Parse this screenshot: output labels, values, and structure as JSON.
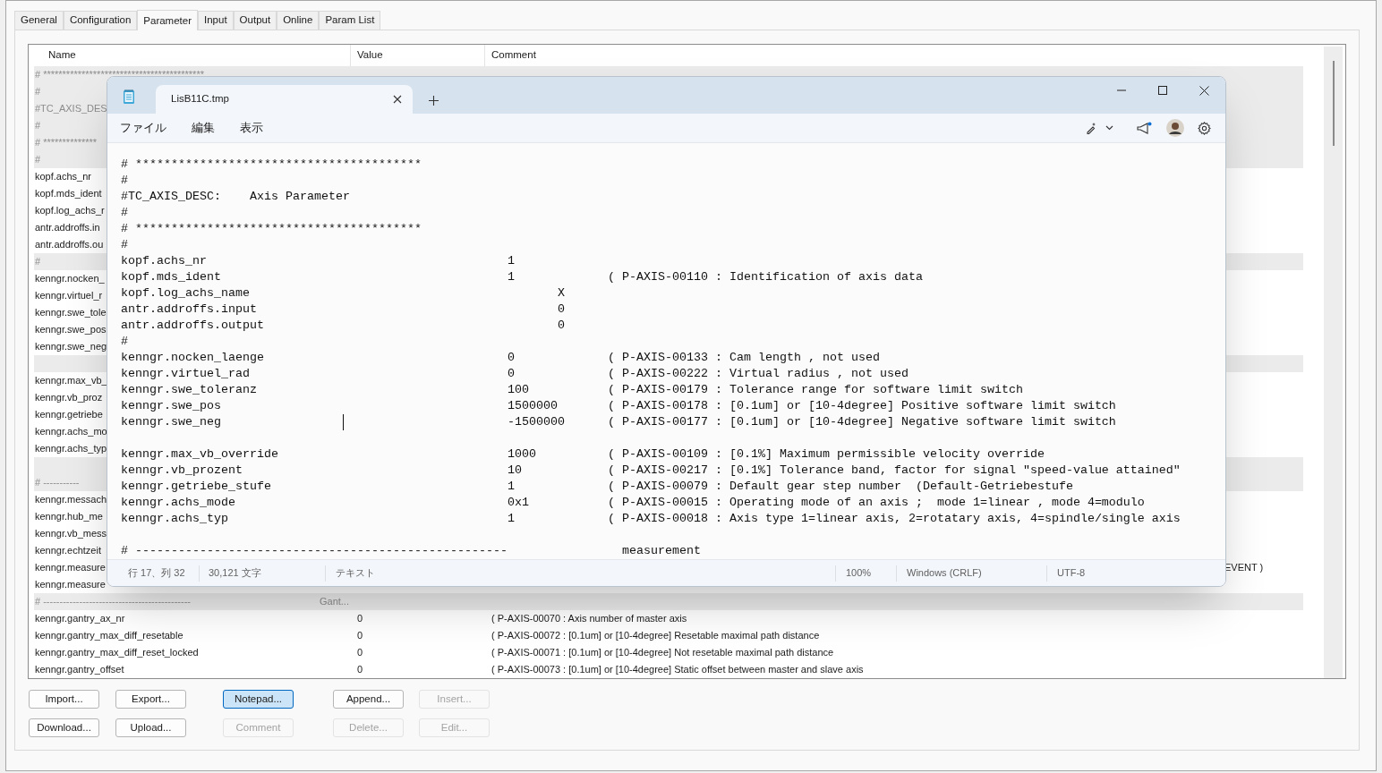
{
  "app": {
    "tabs": [
      {
        "label": "General",
        "selected": false
      },
      {
        "label": "Configuration",
        "selected": false
      },
      {
        "label": "Parameter",
        "selected": true
      },
      {
        "label": "Input",
        "selected": false
      },
      {
        "label": "Output",
        "selected": false
      },
      {
        "label": "Online",
        "selected": false
      },
      {
        "label": "Param List",
        "selected": false
      }
    ],
    "table": {
      "columns": [
        "Name",
        "Value",
        "Comment"
      ],
      "rows": [
        {
          "kind": "comment",
          "name": "# ******************************************"
        },
        {
          "kind": "comment",
          "name": "#"
        },
        {
          "kind": "comment",
          "name": "#TC_AXIS_DES"
        },
        {
          "kind": "comment",
          "name": "#"
        },
        {
          "kind": "comment",
          "name": "# **************"
        },
        {
          "kind": "comment",
          "name": "#"
        },
        {
          "kind": "param",
          "name": "kopf.achs_nr"
        },
        {
          "kind": "param",
          "name": "kopf.mds_ident"
        },
        {
          "kind": "param",
          "name": "kopf.log_achs_r"
        },
        {
          "kind": "param",
          "name": "antr.addroffs.in"
        },
        {
          "kind": "param",
          "name": "antr.addroffs.ou"
        },
        {
          "kind": "comment",
          "name": "#"
        },
        {
          "kind": "param",
          "name": "kenngr.nocken_"
        },
        {
          "kind": "param",
          "name": "kenngr.virtuel_r"
        },
        {
          "kind": "param",
          "name": "kenngr.swe_tole"
        },
        {
          "kind": "param",
          "name": "kenngr.swe_pos"
        },
        {
          "kind": "param",
          "name": "kenngr.swe_neg"
        },
        {
          "kind": "blank"
        },
        {
          "kind": "param",
          "name": "kenngr.max_vb_"
        },
        {
          "kind": "param",
          "name": "kenngr.vb_proz"
        },
        {
          "kind": "param",
          "name": "kenngr.getriebe"
        },
        {
          "kind": "param",
          "name": "kenngr.achs_mo"
        },
        {
          "kind": "param",
          "name": "kenngr.achs_typ"
        },
        {
          "kind": "blank"
        },
        {
          "kind": "comment",
          "name": "# -----------"
        },
        {
          "kind": "param",
          "name": "kenngr.messach"
        },
        {
          "kind": "param",
          "name": "kenngr.hub_me"
        },
        {
          "kind": "param",
          "name": "kenngr.vb_mess"
        },
        {
          "kind": "param",
          "name": "kenngr.echtzeit"
        },
        {
          "kind": "param",
          "name": "kenngr.measure",
          "comment_tail": "EVENT )"
        },
        {
          "kind": "param",
          "name": "kenngr.measure"
        },
        {
          "kind": "comment",
          "name": "# ---------------------------------------------",
          "name_tail": "Gant..."
        },
        {
          "kind": "param",
          "name": "kenngr.gantry_ax_nr",
          "value": "0",
          "comment": "( P-AXIS-00070 : Axis number of master axis"
        },
        {
          "kind": "param",
          "name": "kenngr.gantry_max_diff_resetable",
          "value": "0",
          "comment": "( P-AXIS-00072 : [0.1um] or [10-4degree] Resetable maximal path distance"
        },
        {
          "kind": "param",
          "name": "kenngr.gantry_max_diff_reset_locked",
          "value": "0",
          "comment": "( P-AXIS-00071 : [0.1um] or [10-4degree] Not resetable maximal path distance"
        },
        {
          "kind": "param",
          "name": "kenngr.gantry_offset",
          "value": "0",
          "comment": "( P-AXIS-00073 : [0.1um] or [10-4degree] Static offset between master and slave axis"
        }
      ]
    },
    "buttons": [
      [
        {
          "label": "Import...",
          "focused": false,
          "disabled": false
        },
        {
          "label": "Export...",
          "focused": false,
          "disabled": false
        },
        {
          "label": "Notepad...",
          "focused": true,
          "disabled": false
        },
        {
          "label": "Append...",
          "focused": false,
          "disabled": false
        },
        {
          "label": "Insert...",
          "focused": false,
          "disabled": true
        }
      ],
      [
        {
          "label": "Download...",
          "focused": false,
          "disabled": false
        },
        {
          "label": "Upload...",
          "focused": false,
          "disabled": false
        },
        {
          "label": "Comment",
          "focused": false,
          "disabled": true
        },
        {
          "label": "Delete...",
          "focused": false,
          "disabled": true
        },
        {
          "label": "Edit...",
          "focused": false,
          "disabled": true
        }
      ]
    ]
  },
  "notepad": {
    "tab_title": "LisB11C.tmp",
    "menu": [
      "ファイル",
      "編集",
      "表示"
    ],
    "lines": [
      {
        "kind": "comment",
        "text": "# ****************************************"
      },
      {
        "kind": "comment",
        "text": "#"
      },
      {
        "kind": "comment",
        "text": "#TC_AXIS_DESC:    Axis Parameter"
      },
      {
        "kind": "comment",
        "text": "#"
      },
      {
        "kind": "comment",
        "text": "# ****************************************"
      },
      {
        "kind": "comment",
        "text": "#"
      },
      {
        "kind": "entry",
        "name": "kopf.achs_nr",
        "value": "1"
      },
      {
        "kind": "entry",
        "name": "kopf.mds_ident",
        "value": "1",
        "comment": "( P-AXIS-00110 : Identification of axis data"
      },
      {
        "kind": "entry_shifted",
        "name": "kopf.log_achs_name",
        "value": "X"
      },
      {
        "kind": "entry_shifted",
        "name": "antr.addroffs.input",
        "value": "0"
      },
      {
        "kind": "entry_shifted",
        "name": "antr.addroffs.output",
        "value": "0"
      },
      {
        "kind": "comment",
        "text": "#"
      },
      {
        "kind": "entry",
        "name": "kenngr.nocken_laenge",
        "value": "0",
        "comment": "( P-AXIS-00133 : Cam length , not used"
      },
      {
        "kind": "entry",
        "name": "kenngr.virtuel_rad",
        "value": "0",
        "comment": "( P-AXIS-00222 : Virtual radius , not used"
      },
      {
        "kind": "entry",
        "name": "kenngr.swe_toleranz",
        "value": "100",
        "comment": "( P-AXIS-00179 : Tolerance range for software limit switch"
      },
      {
        "kind": "entry",
        "name": "kenngr.swe_pos",
        "value": "1500000",
        "comment": "( P-AXIS-00178 : [0.1um] or [10-4degree] Positive software limit switch"
      },
      {
        "kind": "entry",
        "name": "kenngr.swe_neg",
        "value": "-1500000",
        "comment": "( P-AXIS-00177 : [0.1um] or [10-4degree] Negative software limit switch"
      },
      {
        "kind": "blank"
      },
      {
        "kind": "entry",
        "name": "kenngr.max_vb_override",
        "value": "1000",
        "comment": "( P-AXIS-00109 : [0.1%] Maximum permissible velocity override"
      },
      {
        "kind": "entry",
        "name": "kenngr.vb_prozent",
        "value": "10",
        "comment": "( P-AXIS-00217 : [0.1%] Tolerance band, factor for signal \"speed-value attained\""
      },
      {
        "kind": "entry",
        "name": "kenngr.getriebe_stufe",
        "value": "1",
        "comment": "( P-AXIS-00079 : Default gear step number  (Default-Getriebestufe"
      },
      {
        "kind": "entry",
        "name": "kenngr.achs_mode",
        "value": "0x1",
        "comment": "( P-AXIS-00015 : Operating mode of an axis ;  mode 1=linear , mode 4=modulo"
      },
      {
        "kind": "entry",
        "name": "kenngr.achs_typ",
        "value": "1",
        "comment": "( P-AXIS-00018 : Axis type 1=linear axis, 2=rotatary axis, 4=spindle/single axis"
      },
      {
        "kind": "blank"
      },
      {
        "kind": "section",
        "text": "# ----------------------------------------------------",
        "label": "measurement"
      }
    ],
    "status": [
      "行 17、列 32",
      "30,121 文字",
      "テキスト",
      "100%",
      "Windows (CRLF)",
      "UTF-8"
    ]
  }
}
